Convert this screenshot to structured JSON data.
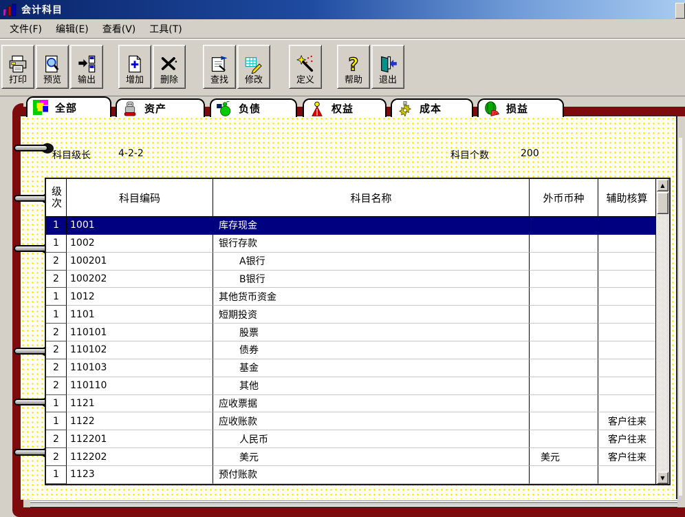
{
  "window": {
    "title": "会计科目"
  },
  "menu": {
    "items": [
      {
        "label": "文件(F)"
      },
      {
        "label": "编辑(E)"
      },
      {
        "label": "查看(V)"
      },
      {
        "label": "工具(T)"
      }
    ]
  },
  "toolbar": {
    "buttons": [
      {
        "label": "打印",
        "icon": "printer-icon"
      },
      {
        "label": "预览",
        "icon": "preview-icon"
      },
      {
        "label": "输出",
        "icon": "export-icon"
      },
      {
        "label": "增加",
        "icon": "add-icon"
      },
      {
        "label": "删除",
        "icon": "delete-icon"
      },
      {
        "label": "查找",
        "icon": "find-icon"
      },
      {
        "label": "修改",
        "icon": "modify-icon"
      },
      {
        "label": "定义",
        "icon": "define-icon"
      },
      {
        "label": "帮助",
        "icon": "help-icon"
      },
      {
        "label": "退出",
        "icon": "exit-icon"
      }
    ]
  },
  "tabs": [
    {
      "label": "全部",
      "active": true,
      "icon": "mosaic-icon"
    },
    {
      "label": "资产",
      "active": false,
      "icon": "robot-icon"
    },
    {
      "label": "负债",
      "active": false,
      "icon": "green-figure-icon"
    },
    {
      "label": "权益",
      "active": false,
      "icon": "red-figure-icon"
    },
    {
      "label": "成本",
      "active": false,
      "icon": "gear-icon"
    },
    {
      "label": "损益",
      "active": false,
      "icon": "watermelon-icon"
    }
  ],
  "info": {
    "level_label": "科目级长",
    "level_value": "4-2-2",
    "count_label": "科目个数",
    "count_value": "200"
  },
  "table": {
    "columns": [
      "级次",
      "科目编码",
      "科目名称",
      "外币币种",
      "辅助核算"
    ],
    "rows": [
      {
        "level": "1",
        "code": "1001",
        "name": "库存现金",
        "currency": "",
        "aux": "",
        "selected": true
      },
      {
        "level": "1",
        "code": "1002",
        "name": "银行存款",
        "currency": "",
        "aux": "",
        "selected": false
      },
      {
        "level": "2",
        "code": "100201",
        "name": "A银行",
        "currency": "",
        "aux": "",
        "selected": false
      },
      {
        "level": "2",
        "code": "100202",
        "name": "B银行",
        "currency": "",
        "aux": "",
        "selected": false
      },
      {
        "level": "1",
        "code": "1012",
        "name": "其他货币资金",
        "currency": "",
        "aux": "",
        "selected": false
      },
      {
        "level": "1",
        "code": "1101",
        "name": "短期投资",
        "currency": "",
        "aux": "",
        "selected": false
      },
      {
        "level": "2",
        "code": "110101",
        "name": "股票",
        "currency": "",
        "aux": "",
        "selected": false
      },
      {
        "level": "2",
        "code": "110102",
        "name": "债券",
        "currency": "",
        "aux": "",
        "selected": false
      },
      {
        "level": "2",
        "code": "110103",
        "name": "基金",
        "currency": "",
        "aux": "",
        "selected": false
      },
      {
        "level": "2",
        "code": "110110",
        "name": "其他",
        "currency": "",
        "aux": "",
        "selected": false
      },
      {
        "level": "1",
        "code": "1121",
        "name": "应收票据",
        "currency": "",
        "aux": "",
        "selected": false
      },
      {
        "level": "1",
        "code": "1122",
        "name": "应收账款",
        "currency": "",
        "aux": "客户往来",
        "selected": false
      },
      {
        "level": "2",
        "code": "112201",
        "name": "人民币",
        "currency": "",
        "aux": "客户往来",
        "selected": false
      },
      {
        "level": "2",
        "code": "112202",
        "name": "美元",
        "currency": "美元",
        "aux": "客户往来",
        "selected": false
      },
      {
        "level": "1",
        "code": "1123",
        "name": "预付账款",
        "currency": "",
        "aux": "",
        "selected": false
      }
    ]
  }
}
